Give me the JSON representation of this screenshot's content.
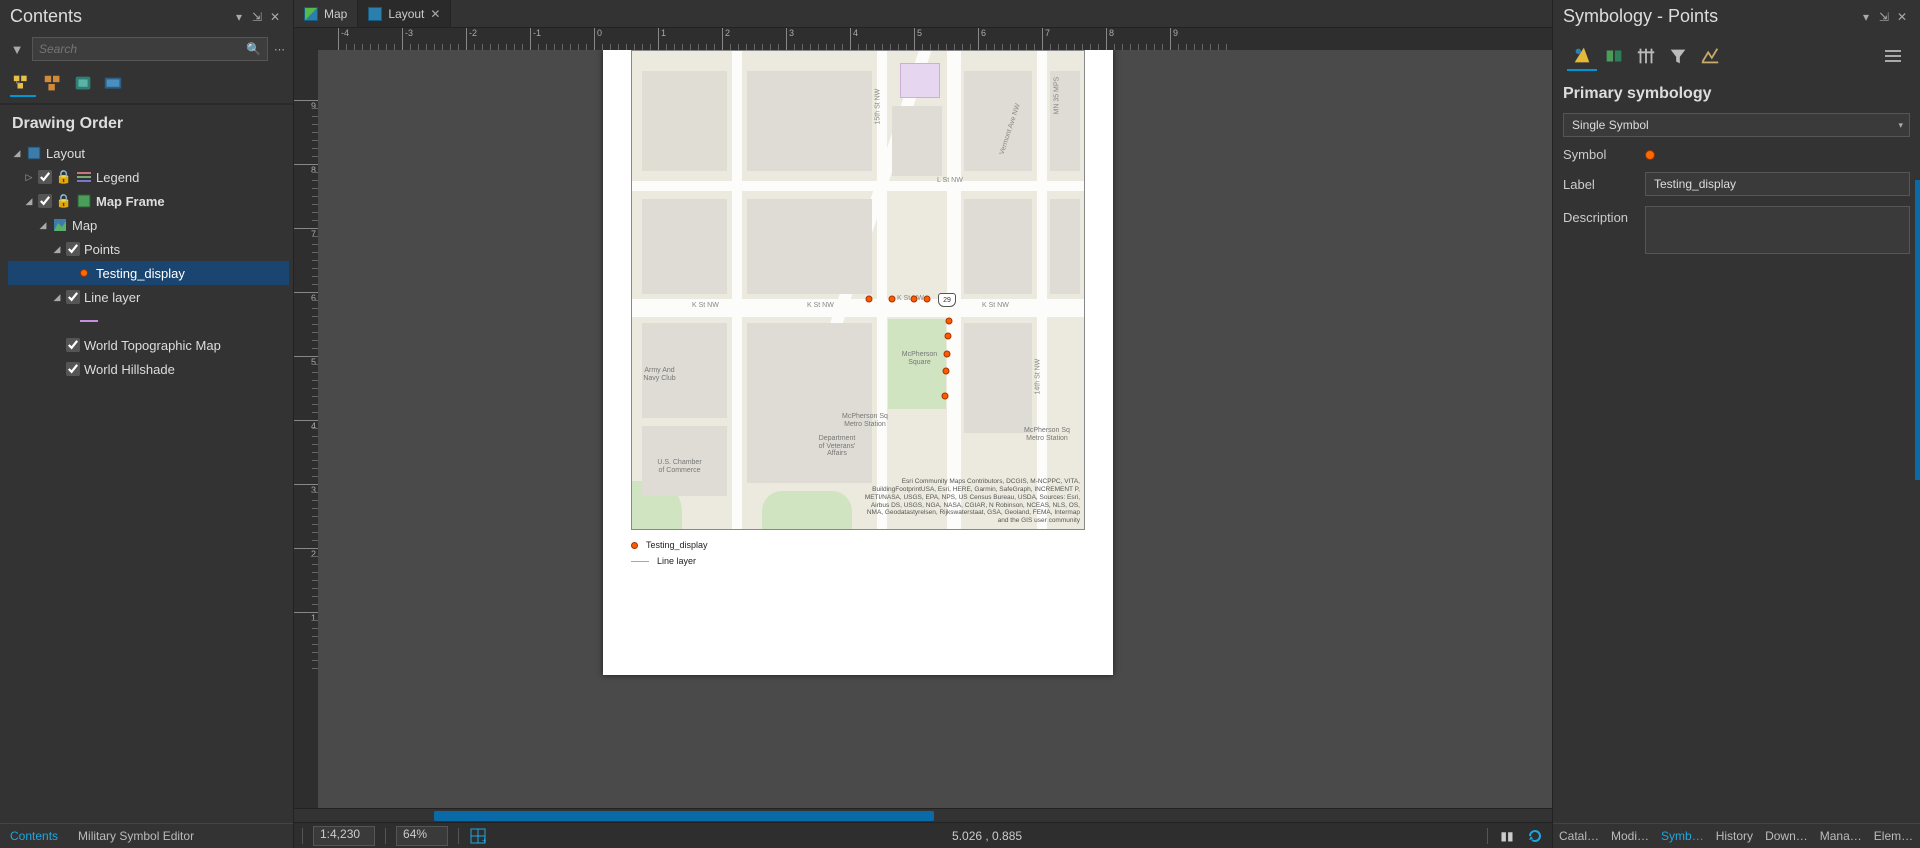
{
  "contents": {
    "title": "Contents",
    "search_placeholder": "Search",
    "section": "Drawing Order",
    "tree": {
      "layout": "Layout",
      "legend": "Legend",
      "map_frame": "Map Frame",
      "map": "Map",
      "points": "Points",
      "points_class": "Testing_display",
      "line_layer": "Line layer",
      "base1": "World Topographic Map",
      "base2": "World Hillshade"
    },
    "bottom_tabs": {
      "contents": "Contents",
      "mse": "Military Symbol Editor"
    }
  },
  "view": {
    "tabs": {
      "map": "Map",
      "layout": "Layout"
    },
    "ruler_h": [
      "-4",
      "-3",
      "-2",
      "-1",
      "0",
      "1",
      "2",
      "3",
      "4",
      "5",
      "6",
      "7",
      "8",
      "9"
    ],
    "ruler_v": [
      "9",
      "8",
      "7",
      "6",
      "5",
      "4",
      "3",
      "2",
      "1"
    ],
    "legend": {
      "item1": "Testing_display",
      "item2": "Line layer"
    },
    "map_labels": {
      "kst_left1": "K St NW",
      "kst_left2": "K St NW",
      "kst_mid": "K St NW",
      "kst_right": "K St NW",
      "lst": "L St NW",
      "lst2": "L St NW",
      "mcpherson": "McPherson\nSquare",
      "mcpherson_metro": "McPherson Sq\nMetro Station",
      "mcpherson_metro2": "McPherson Sq\nMetro Station",
      "navy": "Army And\nNavy Club",
      "chamber": "U.S. Chamber\nof Commerce",
      "veterans": "Department\nof Veterans'\nAffairs",
      "vermont": "Vermont Ave NW",
      "street14": "14th St NW",
      "street15": "15th St NW",
      "mn30": "MN 35 MPS",
      "shield": "29"
    },
    "attribution": "Esri Community Maps Contributors, DCGIS, M-NCPPC, VITA, BuildingFootprintUSA, Esri, HERE, Garmin, SafeGraph, INCREMENT P, METI/NASA, USGS, EPA, NPS, US Census Bureau, USDA, Sources: Esri, Airbus DS, USGS, NGA, NASA, CGIAR, N Robinson, NCEAS, NLS, OS, NMA, Geodatastyrelsen, Rijkswaterstaat, GSA, Geoland, FEMA, Intermap and the GIS user community"
  },
  "status": {
    "scale": "1:4,230",
    "zoom": "64%",
    "coords": "5.026 , 0.885"
  },
  "symbology": {
    "title": "Symbology - Points",
    "section": "Primary symbology",
    "mode": "Single Symbol",
    "labels": {
      "symbol": "Symbol",
      "label": "Label",
      "description": "Description"
    },
    "values": {
      "label": "Testing_display",
      "description": ""
    },
    "bottom_tabs": [
      "Catal…",
      "Modi…",
      "Symb…",
      "History",
      "Down…",
      "Mana…",
      "Elem…"
    ]
  }
}
